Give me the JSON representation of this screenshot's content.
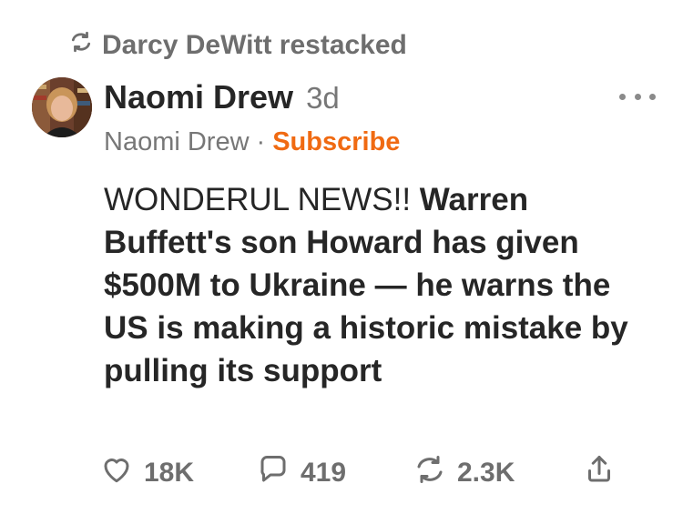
{
  "restack": {
    "label": "Darcy DeWitt restacked",
    "icon": "restack-icon"
  },
  "post": {
    "author": "Naomi Drew",
    "time": "3d",
    "publication": "Naomi Drew",
    "separator": "·",
    "subscribe_label": "Subscribe",
    "body_lead": "WONDERUL NEWS!!",
    "body_bold": "Warren Buffett's son Howard has given $500M to Ukraine — he warns the US is making a historic mistake by pulling its support"
  },
  "actions": {
    "likes": "18K",
    "comments": "419",
    "restacks": "2.3K"
  },
  "colors": {
    "accent": "#f06a12",
    "text": "#262626",
    "muted": "#777777"
  },
  "icons": [
    "restack-icon",
    "heart-icon",
    "comment-icon",
    "restack-icon",
    "share-icon",
    "more-icon"
  ]
}
